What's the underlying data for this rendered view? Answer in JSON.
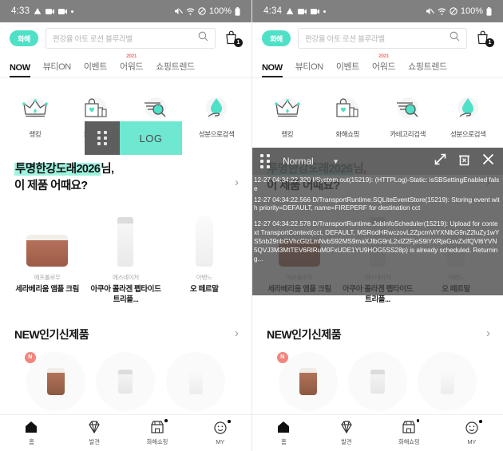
{
  "panels": [
    {
      "id": "left",
      "status": {
        "time": "4:33",
        "battery": "100%",
        "icons_left": [
          "warning-icon",
          "video-icon",
          "video-icon",
          "dot-icon"
        ],
        "icons_right": [
          "mute-icon",
          "wifi-icon",
          "do-not-disturb-icon",
          "battery-icon"
        ]
      }
    },
    {
      "id": "right",
      "status": {
        "time": "4:34",
        "battery": "100%",
        "icons_left": [
          "warning-icon",
          "video-icon",
          "video-icon",
          "dot-icon"
        ],
        "icons_right": [
          "mute-icon",
          "wifi-icon",
          "do-not-disturb-icon",
          "battery-icon"
        ]
      }
    }
  ],
  "header": {
    "logo_text": "화해",
    "search_placeholder": "편강율 아토 로션 블루라벨",
    "search_icon": "search-icon",
    "cart_icon": "cart-icon",
    "cart_badge": "1"
  },
  "tabs": [
    {
      "label": "NOW",
      "active": true,
      "sup": ""
    },
    {
      "label": "뷰티ON",
      "active": false,
      "sup": ""
    },
    {
      "label": "이벤트",
      "active": false,
      "sup": ""
    },
    {
      "label": "어워드",
      "active": false,
      "sup": "2021"
    },
    {
      "label": "쇼핑트렌드",
      "active": false,
      "sup": ""
    }
  ],
  "categories": [
    {
      "label": "랭킹",
      "icon": "crown-icon"
    },
    {
      "label": "화해쇼핑",
      "icon": "shopping-bag-heart-icon"
    },
    {
      "label": "카테고리검색",
      "icon": "category-search-icon"
    },
    {
      "label": "성분으로검색",
      "icon": "ingredient-droplet-icon"
    }
  ],
  "banner": {
    "line1_highlight": "투명한강도래2026",
    "line1_rest": "님,",
    "line2": "이 제품 어때요?",
    "arrow_icon": "chevron-right-icon"
  },
  "products": [
    {
      "brand": "에프롤로우",
      "name": "세라베리움 앰플 크림",
      "image": "cream-jar"
    },
    {
      "brand": "에스네이처",
      "name": "아쿠아 콜라겐 펩타이드 트리플...",
      "image": "serum-bottle"
    },
    {
      "brand": "아벤느",
      "name": "오 떼르말",
      "image": "spray-tube"
    }
  ],
  "new_section": {
    "title_en": "NEW",
    "title_kr": "인기신제품",
    "arrow_icon": "chevron-right-icon",
    "items": [
      {
        "image": "brown-bottle",
        "badge": "N"
      },
      {
        "image": "clear-flask",
        "badge": ""
      },
      {
        "image": "white-tube",
        "badge": ""
      }
    ]
  },
  "bottom_nav": [
    {
      "label": "홈",
      "icon": "home-icon",
      "active": true,
      "dot": false
    },
    {
      "label": "발견",
      "icon": "diamond-icon",
      "active": false,
      "dot": false
    },
    {
      "label": "화해쇼핑",
      "icon": "store-icon",
      "active": false,
      "dot": true
    },
    {
      "label": "MY",
      "icon": "smiley-icon",
      "active": false,
      "dot": true
    }
  ],
  "log_widget": {
    "handle_icon": "drag-handle-icon",
    "label": "LOG"
  },
  "log_overlay": {
    "handle_icon": "drag-handle-icon",
    "level": "Normal",
    "caret_icon": "chevron-down-icon",
    "expand_icon": "expand-arrows-icon",
    "clear_icon": "trash-icon",
    "close_icon": "close-icon",
    "lines": [
      "12-27 04:34:22.320 I/System.out(15219): (HTTPLog)-Static: isSBSettingEnabled false",
      "12-27 04:34:22.566 D/TransportRuntime.SQLiteEventStore(15219): Storing event with priority=DEFAULT, name=FIREPERF for destination cct",
      "12-27 04:34:22.578 D/TransportRuntime.JobInfoScheduler(15219): Upload for context TransportContext(cct, DEFAULT, MSRodHRwczovL2ZpcmViYXNlbG9nZ2luZy1wYS5nb29nbGVhcGlzLmNvbS92MS9maXJlbG9nL2xlZ2FjeS9iYXRjaGxvZxIfQVl6YVN5QVJ3M3MtTEV6RlRuM0FxUDE1YU9HOG5SS28p) is already scheduled. Returning..."
    ]
  }
}
